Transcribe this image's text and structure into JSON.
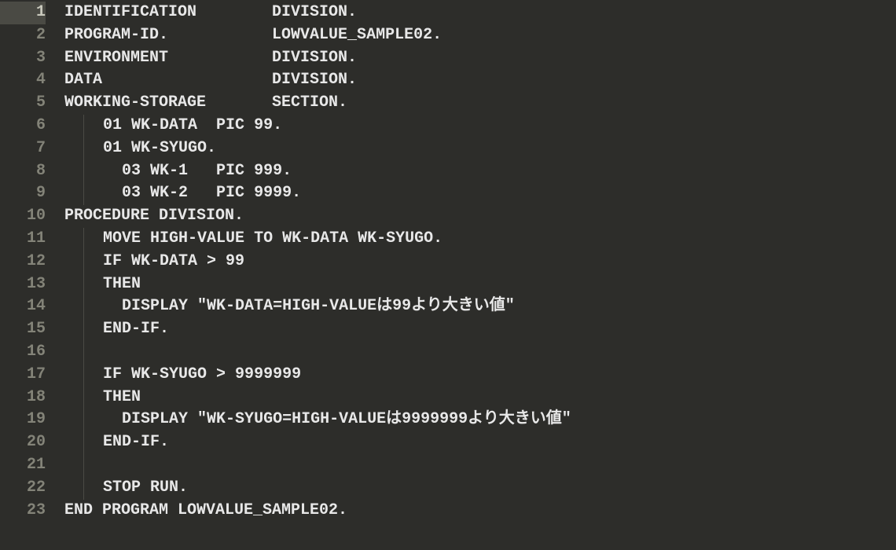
{
  "editor": {
    "lines": [
      {
        "num": "1",
        "text": "IDENTIFICATION        DIVISION.",
        "indent": 0,
        "current": true
      },
      {
        "num": "2",
        "text": "PROGRAM-ID.           LOWVALUE_SAMPLE02.",
        "indent": 0
      },
      {
        "num": "3",
        "text": "ENVIRONMENT           DIVISION.",
        "indent": 0
      },
      {
        "num": "4",
        "text": "DATA                  DIVISION.",
        "indent": 0
      },
      {
        "num": "5",
        "text": "WORKING-STORAGE       SECTION.",
        "indent": 0
      },
      {
        "num": "6",
        "text": "01 WK-DATA  PIC 99.",
        "indent": 1
      },
      {
        "num": "7",
        "text": "01 WK-SYUGO.",
        "indent": 1
      },
      {
        "num": "8",
        "text": "  03 WK-1   PIC 999.",
        "indent": 1
      },
      {
        "num": "9",
        "text": "  03 WK-2   PIC 9999.",
        "indent": 1
      },
      {
        "num": "10",
        "text": "PROCEDURE DIVISION.",
        "indent": 0
      },
      {
        "num": "11",
        "text": "MOVE HIGH-VALUE TO WK-DATA WK-SYUGO.",
        "indent": 1
      },
      {
        "num": "12",
        "text": "IF WK-DATA > 99",
        "indent": 1
      },
      {
        "num": "13",
        "text": "THEN",
        "indent": 1
      },
      {
        "num": "14",
        "text": "  DISPLAY \"WK-DATA=HIGH-VALUEは99より大きい値\"",
        "indent": 1
      },
      {
        "num": "15",
        "text": "END-IF.",
        "indent": 1
      },
      {
        "num": "16",
        "text": "",
        "indent": 1
      },
      {
        "num": "17",
        "text": "IF WK-SYUGO > 9999999",
        "indent": 1
      },
      {
        "num": "18",
        "text": "THEN",
        "indent": 1
      },
      {
        "num": "19",
        "text": "  DISPLAY \"WK-SYUGO=HIGH-VALUEは9999999より大きい値\"",
        "indent": 1
      },
      {
        "num": "20",
        "text": "END-IF.",
        "indent": 1
      },
      {
        "num": "21",
        "text": "",
        "indent": 1
      },
      {
        "num": "22",
        "text": "STOP RUN.",
        "indent": 1
      },
      {
        "num": "23",
        "text": "END PROGRAM LOWVALUE_SAMPLE02.",
        "indent": 0
      }
    ]
  }
}
